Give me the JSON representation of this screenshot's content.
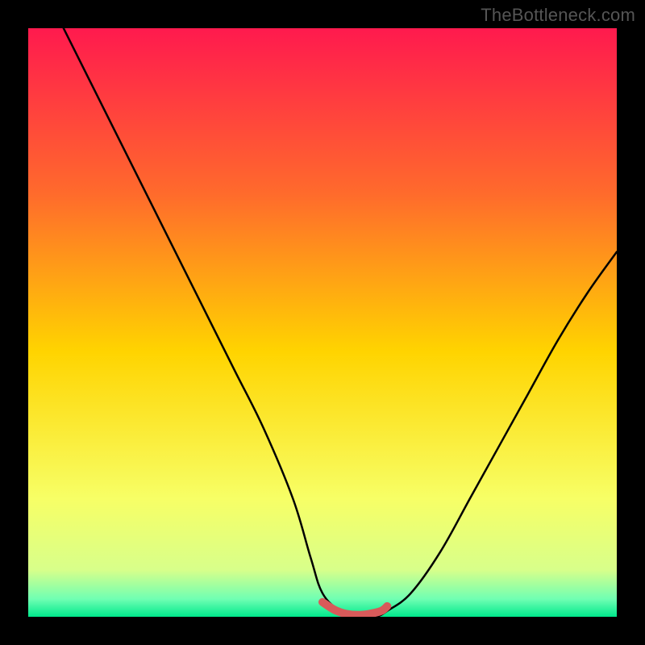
{
  "watermark": "TheBottleneck.com",
  "colors": {
    "frame": "#000000",
    "gradient_top": "#ff1a4e",
    "gradient_upper": "#ff6a2c",
    "gradient_mid": "#ffd400",
    "gradient_lower": "#f7ff66",
    "gradient_base1": "#d8ff8a",
    "gradient_base2": "#6fffb3",
    "gradient_bottom": "#00e88c",
    "curve_main": "#000000",
    "curve_highlight": "#d85a5a"
  },
  "chart_data": {
    "type": "line",
    "title": "",
    "xlabel": "",
    "ylabel": "",
    "xlim": [
      0,
      100
    ],
    "ylim": [
      0,
      100
    ],
    "series": [
      {
        "name": "bottleneck-curve",
        "x": [
          6,
          10,
          15,
          20,
          25,
          30,
          35,
          40,
          45,
          48,
          50,
          53,
          56,
          59,
          61,
          65,
          70,
          75,
          80,
          85,
          90,
          95,
          100
        ],
        "y": [
          100,
          92,
          82,
          72,
          62,
          52,
          42,
          32,
          20,
          10,
          4,
          1,
          0,
          0,
          1,
          4,
          11,
          20,
          29,
          38,
          47,
          55,
          62
        ]
      },
      {
        "name": "optimal-range-highlight",
        "x": [
          50,
          52,
          54,
          56,
          58,
          60,
          61
        ],
        "y": [
          2.5,
          1.2,
          0.5,
          0.3,
          0.5,
          1.0,
          1.8
        ]
      }
    ],
    "annotations": []
  }
}
